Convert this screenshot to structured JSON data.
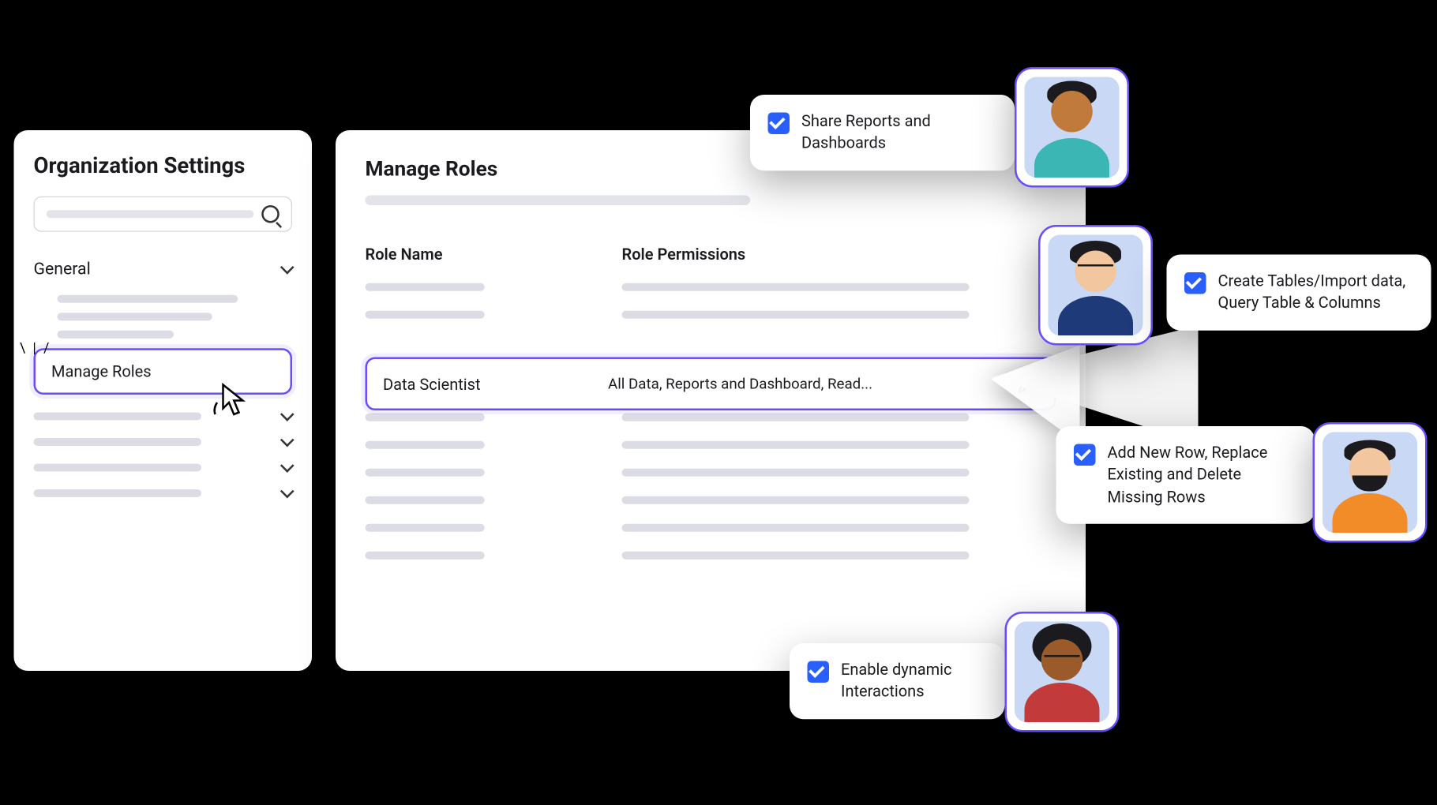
{
  "sidebar": {
    "title": "Organization Settings",
    "section_general": "General",
    "manage_roles_label": "Manage Roles"
  },
  "main": {
    "title": "Manage Roles",
    "col_role_name": "Role Name",
    "col_role_permissions": "Role Permissions",
    "selected_role": {
      "name": "Data Scientist",
      "permissions": "All Data, Reports and Dashboard, Read..."
    }
  },
  "callouts": {
    "c1": "Share Reports and Dashboards",
    "c2": "Create Tables/Import data, Query Table & Columns",
    "c3": "Add New Row, Replace Existing and Delete Missing Rows",
    "c4": "Enable dynamic Interactions"
  }
}
